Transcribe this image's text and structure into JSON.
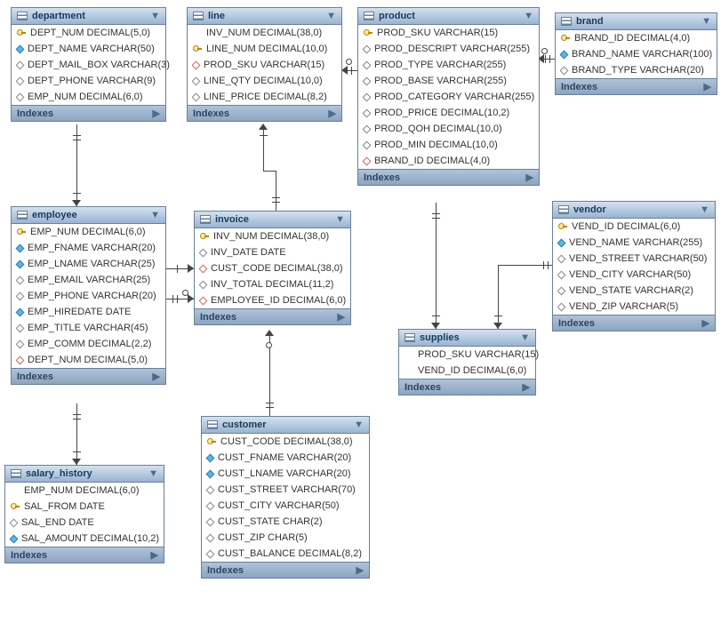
{
  "footer_label": "Indexes",
  "entities": {
    "department": {
      "title": "department",
      "columns": [
        {
          "icon": "key",
          "text": "DEPT_NUM DECIMAL(5,0)"
        },
        {
          "icon": "filled",
          "text": "DEPT_NAME VARCHAR(50)"
        },
        {
          "icon": "open",
          "text": "DEPT_MAIL_BOX VARCHAR(3)"
        },
        {
          "icon": "open",
          "text": "DEPT_PHONE VARCHAR(9)"
        },
        {
          "icon": "open",
          "text": "EMP_NUM DECIMAL(6,0)"
        }
      ]
    },
    "line": {
      "title": "line",
      "columns": [
        {
          "icon": "none",
          "text": "INV_NUM DECIMAL(38,0)"
        },
        {
          "icon": "key",
          "text": "LINE_NUM DECIMAL(10,0)"
        },
        {
          "icon": "red",
          "text": "PROD_SKU VARCHAR(15)"
        },
        {
          "icon": "open",
          "text": "LINE_QTY DECIMAL(10,0)"
        },
        {
          "icon": "open",
          "text": "LINE_PRICE DECIMAL(8,2)"
        }
      ]
    },
    "product": {
      "title": "product",
      "columns": [
        {
          "icon": "key",
          "text": "PROD_SKU VARCHAR(15)"
        },
        {
          "icon": "open",
          "text": "PROD_DESCRIPT VARCHAR(255)"
        },
        {
          "icon": "open",
          "text": "PROD_TYPE VARCHAR(255)"
        },
        {
          "icon": "open",
          "text": "PROD_BASE VARCHAR(255)"
        },
        {
          "icon": "open",
          "text": "PROD_CATEGORY VARCHAR(255)"
        },
        {
          "icon": "open",
          "text": "PROD_PRICE DECIMAL(10,2)"
        },
        {
          "icon": "open",
          "text": "PROD_QOH DECIMAL(10,0)"
        },
        {
          "icon": "open",
          "text": "PROD_MIN DECIMAL(10,0)"
        },
        {
          "icon": "red",
          "text": "BRAND_ID DECIMAL(4,0)"
        }
      ]
    },
    "brand": {
      "title": "brand",
      "columns": [
        {
          "icon": "key",
          "text": "BRAND_ID DECIMAL(4,0)"
        },
        {
          "icon": "filled",
          "text": "BRAND_NAME VARCHAR(100)"
        },
        {
          "icon": "open",
          "text": "BRAND_TYPE VARCHAR(20)"
        }
      ]
    },
    "employee": {
      "title": "employee",
      "columns": [
        {
          "icon": "key",
          "text": "EMP_NUM DECIMAL(6,0)"
        },
        {
          "icon": "filled",
          "text": "EMP_FNAME VARCHAR(20)"
        },
        {
          "icon": "filled",
          "text": "EMP_LNAME VARCHAR(25)"
        },
        {
          "icon": "open",
          "text": "EMP_EMAIL VARCHAR(25)"
        },
        {
          "icon": "open",
          "text": "EMP_PHONE VARCHAR(20)"
        },
        {
          "icon": "filled",
          "text": "EMP_HIREDATE DATE"
        },
        {
          "icon": "open",
          "text": "EMP_TITLE VARCHAR(45)"
        },
        {
          "icon": "open",
          "text": "EMP_COMM DECIMAL(2,2)"
        },
        {
          "icon": "red",
          "text": "DEPT_NUM DECIMAL(5,0)"
        }
      ]
    },
    "invoice": {
      "title": "invoice",
      "columns": [
        {
          "icon": "key",
          "text": "INV_NUM DECIMAL(38,0)"
        },
        {
          "icon": "open",
          "text": "INV_DATE DATE"
        },
        {
          "icon": "red",
          "text": "CUST_CODE DECIMAL(38,0)"
        },
        {
          "icon": "open",
          "text": "INV_TOTAL DECIMAL(11,2)"
        },
        {
          "icon": "red",
          "text": "EMPLOYEE_ID DECIMAL(6,0)"
        }
      ]
    },
    "vendor": {
      "title": "vendor",
      "columns": [
        {
          "icon": "key",
          "text": "VEND_ID DECIMAL(6,0)"
        },
        {
          "icon": "filled",
          "text": "VEND_NAME VARCHAR(255)"
        },
        {
          "icon": "open",
          "text": "VEND_STREET VARCHAR(50)"
        },
        {
          "icon": "open",
          "text": "VEND_CITY VARCHAR(50)"
        },
        {
          "icon": "open",
          "text": "VEND_STATE VARCHAR(2)"
        },
        {
          "icon": "open",
          "text": "VEND_ZIP VARCHAR(5)"
        }
      ]
    },
    "supplies": {
      "title": "supplies",
      "columns": [
        {
          "icon": "none",
          "text": "PROD_SKU VARCHAR(15)"
        },
        {
          "icon": "none",
          "text": "VEND_ID DECIMAL(6,0)"
        }
      ]
    },
    "salary_history": {
      "title": "salary_history",
      "columns": [
        {
          "icon": "none",
          "text": "EMP_NUM DECIMAL(6,0)"
        },
        {
          "icon": "key",
          "text": "SAL_FROM DATE"
        },
        {
          "icon": "open",
          "text": "SAL_END DATE"
        },
        {
          "icon": "filled",
          "text": "SAL_AMOUNT DECIMAL(10,2)"
        }
      ]
    },
    "customer": {
      "title": "customer",
      "columns": [
        {
          "icon": "key",
          "text": "CUST_CODE DECIMAL(38,0)"
        },
        {
          "icon": "filled",
          "text": "CUST_FNAME VARCHAR(20)"
        },
        {
          "icon": "filled",
          "text": "CUST_LNAME VARCHAR(20)"
        },
        {
          "icon": "open",
          "text": "CUST_STREET VARCHAR(70)"
        },
        {
          "icon": "open",
          "text": "CUST_CITY VARCHAR(50)"
        },
        {
          "icon": "open",
          "text": "CUST_STATE CHAR(2)"
        },
        {
          "icon": "open",
          "text": "CUST_ZIP CHAR(5)"
        },
        {
          "icon": "open",
          "text": "CUST_BALANCE DECIMAL(8,2)"
        }
      ]
    }
  }
}
